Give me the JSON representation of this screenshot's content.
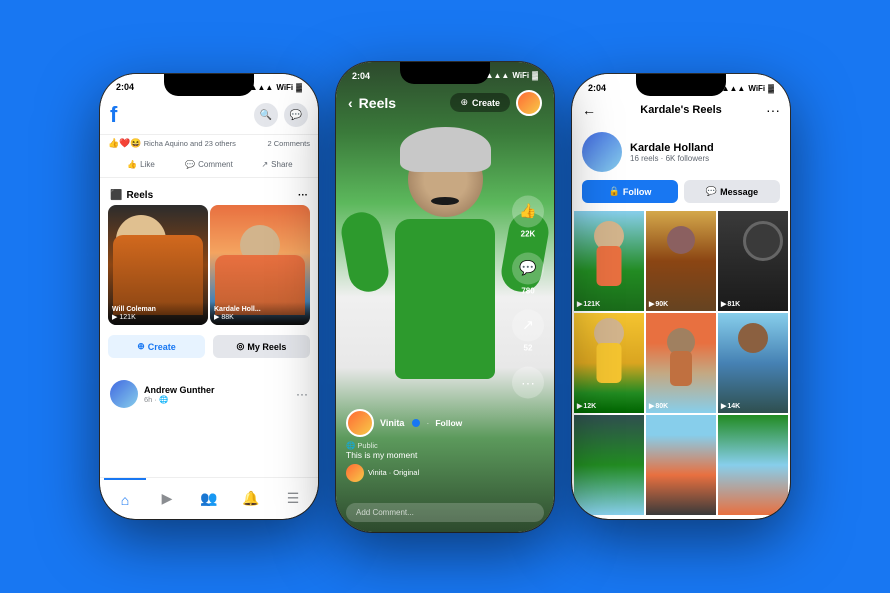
{
  "app": {
    "background_color": "#1877F2"
  },
  "phone_left": {
    "status_bar": {
      "time": "2:04",
      "signal": "▲▲▲",
      "wifi": "WiFi",
      "battery": "🔋"
    },
    "header": {
      "logo": "f",
      "search_icon": "🔍",
      "messenger_icon": "💬"
    },
    "reactions": {
      "text": "Richa Aquino and 23 others",
      "comments": "2 Comments"
    },
    "post_actions": {
      "like": "Like",
      "comment": "Comment",
      "share": "Share"
    },
    "reels_section": {
      "title": "Reels",
      "reel1_name": "Will Coleman",
      "reel1_views": "121K",
      "reel2_name": "Kardale Holl...",
      "reel2_views": "88K",
      "create_btn": "Create",
      "my_reels_btn": "My Reels"
    },
    "post": {
      "name": "Andrew Gunther",
      "time": "6h · 🌐"
    },
    "nav": {
      "home": "⌂",
      "video": "▶",
      "people": "👥",
      "bell": "🔔",
      "menu": "☰"
    }
  },
  "phone_center": {
    "status_bar": {
      "time": "2:04"
    },
    "top_bar": {
      "back_arrow": "‹",
      "title": "Reels",
      "create_label": "Create"
    },
    "creator": {
      "name": "Vinita",
      "verified": true,
      "follow": "Follow",
      "visibility": "Public"
    },
    "caption": "This is my moment",
    "audio": "Vinita · Original",
    "likes": "22K",
    "comments": "780",
    "shares": "52",
    "comment_placeholder": "Add Comment..."
  },
  "phone_right": {
    "status_bar": {
      "time": "2:04"
    },
    "header": {
      "title": "Kardale's Reels",
      "back_icon": "←",
      "more_icon": "···"
    },
    "profile": {
      "name": "Kardale Holland",
      "stats": "16 reels · 6K followers",
      "follow_btn": "Follow",
      "message_btn": "Message"
    },
    "reels": [
      {
        "views": "121K"
      },
      {
        "views": "90K"
      },
      {
        "views": "81K"
      },
      {
        "views": "12K"
      },
      {
        "views": "80K"
      },
      {
        "views": "14K"
      },
      {
        "views": ""
      },
      {
        "views": ""
      },
      {
        "views": ""
      }
    ]
  }
}
